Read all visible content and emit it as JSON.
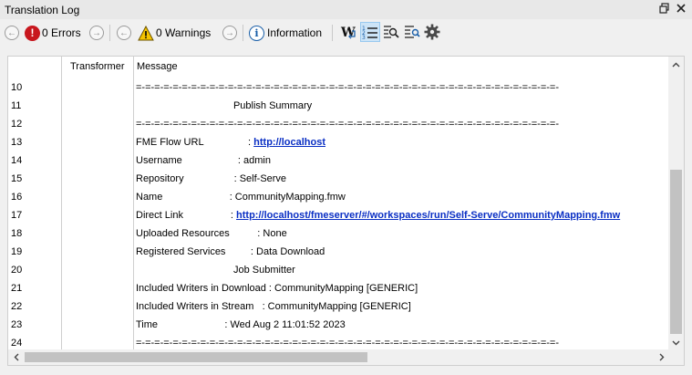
{
  "window": {
    "title": "Translation Log",
    "restore_icon": "restore-icon",
    "close_icon": "close-icon"
  },
  "toolbar": {
    "errors_label": "0 Errors",
    "warnings_label": "0 Warnings",
    "information_label": "Information",
    "icons": [
      "prev-arrow-icon",
      "error-icon",
      "next-arrow-icon",
      "warning-icon",
      "info-icon",
      "word-wrap-icon",
      "numbered-list-icon",
      "find-icon",
      "filter-icon",
      "gear-icon"
    ]
  },
  "log": {
    "columns": [
      "Transformer",
      "Message"
    ],
    "rows": [
      {
        "num": "10",
        "text": "=-=-=-=-=-=-=-=-=-=-=-=-=-=-=-=-=-=-=-=-=-=-=-=-=-=-=-=-=-=-=-=-=-=-=-=-=-=-=-=-=-=-=-=-=-=-"
      },
      {
        "num": "11",
        "text": "                                   Publish Summary"
      },
      {
        "num": "12",
        "text": "=-=-=-=-=-=-=-=-=-=-=-=-=-=-=-=-=-=-=-=-=-=-=-=-=-=-=-=-=-=-=-=-=-=-=-=-=-=-=-=-=-=-=-=-=-=-"
      },
      {
        "num": "13",
        "text": "FME Flow URL                : ",
        "link": "http://localhost"
      },
      {
        "num": "14",
        "text": "Username                    : admin"
      },
      {
        "num": "15",
        "text": "Repository                  : Self-Serve"
      },
      {
        "num": "16",
        "text": "Name                        : CommunityMapping.fmw"
      },
      {
        "num": "17",
        "text": "Direct Link                 : ",
        "link": "http://localhost/fmeserver/#/workspaces/run/Self-Serve/CommunityMapping.fmw"
      },
      {
        "num": "18",
        "text": "Uploaded Resources          : None"
      },
      {
        "num": "19",
        "text": "Registered Services         : Data Download"
      },
      {
        "num": "20",
        "text": "                                   Job Submitter"
      },
      {
        "num": "21",
        "text": "Included Writers in Download : CommunityMapping [GENERIC]"
      },
      {
        "num": "22",
        "text": "Included Writers in Stream   : CommunityMapping [GENERIC]"
      },
      {
        "num": "23",
        "text": "Time                        : Wed Aug 2 11:01:52 2023"
      },
      {
        "num": "24",
        "text": "=-=-=-=-=-=-=-=-=-=-=-=-=-=-=-=-=-=-=-=-=-=-=-=-=-=-=-=-=-=-=-=-=-=-=-=-=-=-=-=-=-=-=-=-=-=-"
      }
    ]
  }
}
